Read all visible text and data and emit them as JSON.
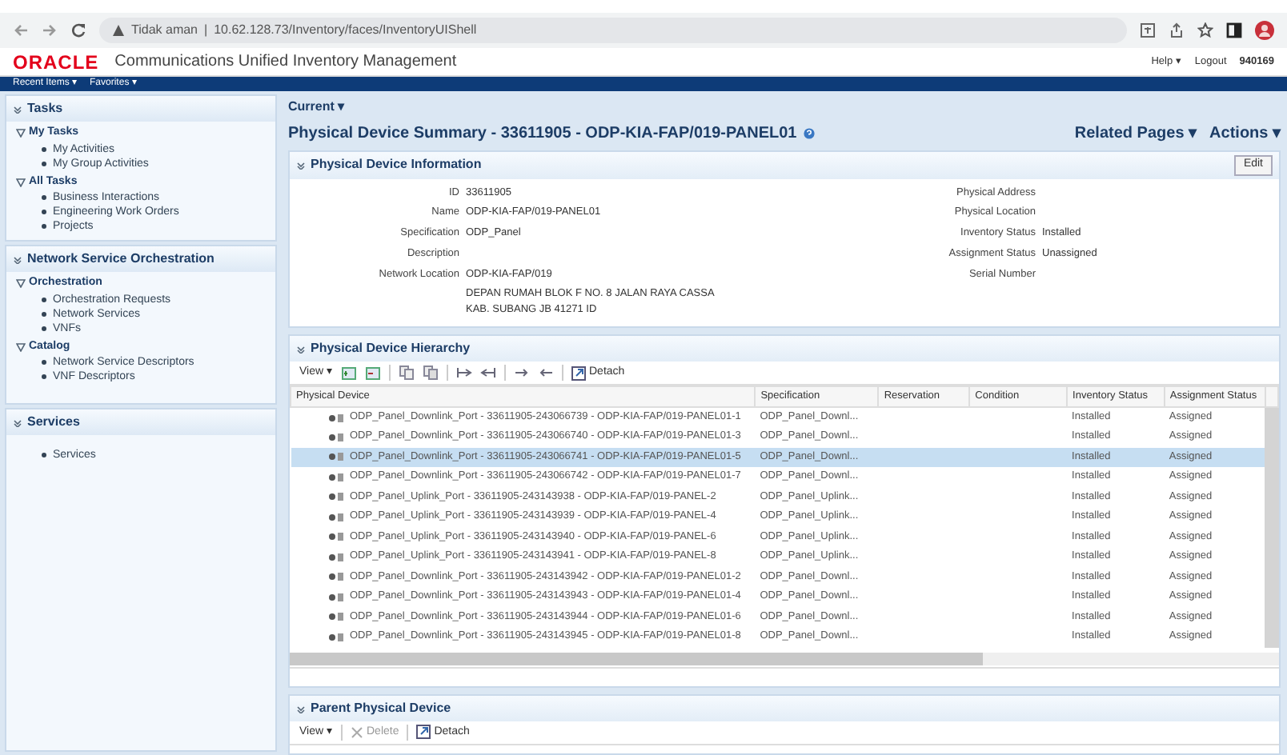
{
  "browser": {
    "security": "Tidak aman",
    "separator": "|",
    "address": "10.62.128.73/Inventory/faces/InventoryUIShell"
  },
  "app": {
    "logo": "ORACLE",
    "title": "Communications Unified Inventory Management",
    "links": [
      "Help ▾",
      "Logout"
    ],
    "user": "940169"
  },
  "menubar": [
    "Recent Items ▾",
    "Favorites ▾"
  ],
  "sidebar": [
    {
      "title": "Tasks",
      "groups": [
        {
          "title": "My Tasks",
          "items": [
            "My Activities",
            "My Group Activities"
          ]
        },
        {
          "title": "All Tasks",
          "items": [
            "Business Interactions",
            "Engineering Work Orders",
            "Projects"
          ]
        }
      ]
    },
    {
      "title": "Network Service Orchestration",
      "groups": [
        {
          "title": "Orchestration",
          "items": [
            "Orchestration Requests",
            "Network Services",
            "VNFs"
          ]
        },
        {
          "title": "Catalog",
          "items": [
            "Network Service Descriptors",
            "VNF Descriptors"
          ]
        }
      ]
    },
    {
      "title": "Services",
      "groups": [
        {
          "items": [
            "Services"
          ]
        }
      ]
    }
  ],
  "breadcrumb": "Current ▾",
  "page_title": "Physical Device Summary - 33611905 - ODP-KIA-FAP/019-PANEL01",
  "page_actions": [
    "Related Pages ▾",
    "Actions ▾"
  ],
  "info_panel": {
    "title": "Physical Device Information",
    "edit": "Edit",
    "left": [
      {
        "label": "ID",
        "value": "33611905"
      },
      {
        "label": "Name",
        "value": "ODP-KIA-FAP/019-PANEL01"
      },
      {
        "label": "Specification",
        "value": "ODP_Panel"
      },
      {
        "label": "Description"
      },
      {
        "label": "Network Location",
        "value": "ODP-KIA-FAP/019",
        "extra": "DEPAN RUMAH BLOK F NO. 8 JALAN RAYA CASSA KAB. SUBANG JB 41271 ID"
      }
    ],
    "right": [
      {
        "label": "Physical Address"
      },
      {
        "label": "Physical Location"
      },
      {
        "label": "Inventory Status",
        "value": "Installed"
      },
      {
        "label": "Assignment Status",
        "value": "Unassigned"
      },
      {
        "label": "Serial Number"
      }
    ]
  },
  "hierarchy": {
    "title": "Physical Device Hierarchy",
    "view": "View ▾",
    "detach": "Detach",
    "columns": [
      "Physical Device",
      "Specification",
      "Reservation",
      "Condition",
      "Inventory Status",
      "Assignment Status"
    ],
    "rows": [
      {
        "device": "ODP_Panel_Downlink_Port - 33611905-243066739 - ODP-KIA-FAP/019-PANEL01-1",
        "spec": "ODP_Panel_Downl...",
        "inventory": "Installed",
        "assignment": "Assigned",
        "selected": false
      },
      {
        "device": "ODP_Panel_Downlink_Port - 33611905-243066740 - ODP-KIA-FAP/019-PANEL01-3",
        "spec": "ODP_Panel_Downl...",
        "inventory": "Installed",
        "assignment": "Assigned",
        "selected": false
      },
      {
        "device": "ODP_Panel_Downlink_Port - 33611905-243066741 - ODP-KIA-FAP/019-PANEL01-5",
        "spec": "ODP_Panel_Downl...",
        "inventory": "Installed",
        "assignment": "Assigned",
        "selected": true
      },
      {
        "device": "ODP_Panel_Downlink_Port - 33611905-243066742 - ODP-KIA-FAP/019-PANEL01-7",
        "spec": "ODP_Panel_Downl...",
        "inventory": "Installed",
        "assignment": "Assigned",
        "selected": false
      },
      {
        "device": "ODP_Panel_Uplink_Port - 33611905-243143938 - ODP-KIA-FAP/019-PANEL-2",
        "spec": "ODP_Panel_Uplink...",
        "inventory": "Installed",
        "assignment": "Assigned",
        "selected": false
      },
      {
        "device": "ODP_Panel_Uplink_Port - 33611905-243143939 - ODP-KIA-FAP/019-PANEL-4",
        "spec": "ODP_Panel_Uplink...",
        "inventory": "Installed",
        "assignment": "Assigned",
        "selected": false
      },
      {
        "device": "ODP_Panel_Uplink_Port - 33611905-243143940 - ODP-KIA-FAP/019-PANEL-6",
        "spec": "ODP_Panel_Uplink...",
        "inventory": "Installed",
        "assignment": "Assigned",
        "selected": false
      },
      {
        "device": "ODP_Panel_Uplink_Port - 33611905-243143941 - ODP-KIA-FAP/019-PANEL-8",
        "spec": "ODP_Panel_Uplink...",
        "inventory": "Installed",
        "assignment": "Assigned",
        "selected": false
      },
      {
        "device": "ODP_Panel_Downlink_Port - 33611905-243143942 - ODP-KIA-FAP/019-PANEL01-2",
        "spec": "ODP_Panel_Downl...",
        "inventory": "Installed",
        "assignment": "Assigned",
        "selected": false
      },
      {
        "device": "ODP_Panel_Downlink_Port - 33611905-243143943 - ODP-KIA-FAP/019-PANEL01-4",
        "spec": "ODP_Panel_Downl...",
        "inventory": "Installed",
        "assignment": "Assigned",
        "selected": false
      },
      {
        "device": "ODP_Panel_Downlink_Port - 33611905-243143944 - ODP-KIA-FAP/019-PANEL01-6",
        "spec": "ODP_Panel_Downl...",
        "inventory": "Installed",
        "assignment": "Assigned",
        "selected": false
      },
      {
        "device": "ODP_Panel_Downlink_Port - 33611905-243143945 - ODP-KIA-FAP/019-PANEL01-8",
        "spec": "ODP_Panel_Downl...",
        "inventory": "Installed",
        "assignment": "Assigned",
        "selected": false
      }
    ]
  },
  "parent_panel": {
    "title": "Parent Physical Device",
    "view": "View ▾",
    "delete": "Delete",
    "detach": "Detach"
  }
}
